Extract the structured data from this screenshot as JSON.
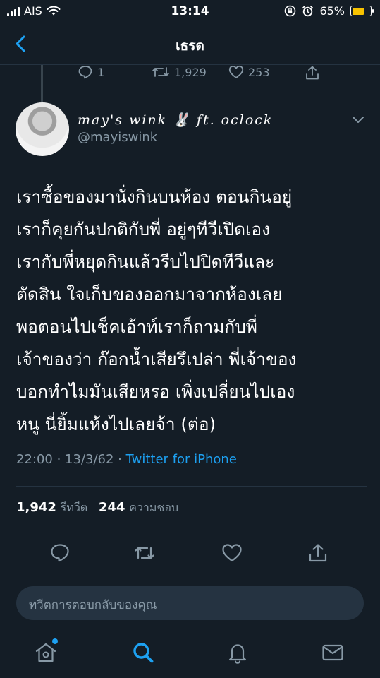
{
  "status_bar": {
    "carrier": "AIS",
    "time": "13:14",
    "battery": "65%",
    "battery_level": 0.65
  },
  "nav": {
    "title": "เธรด"
  },
  "prev_tweet": {
    "replies": "1",
    "retweets": "1,929",
    "likes": "253"
  },
  "tweet": {
    "display_name": "may's wink 🐰 ft. oclock",
    "handle": "@mayiswink",
    "lines": [
      "เราซื้อของมานั่งกินบนห้อง ตอนกินอยู่",
      "เราก็คุยกันปกติกับพี่ อยู่ๆทีวีเปิดเอง",
      "เรากับพี่หยุดกินแล้วรีบไปปิดทีวีและ",
      "ตัดสิน ใจเก็บของออกมาจากห้องเลย",
      "พอตอนไปเช็คเอ้าท์เราก็ถามกับพี่",
      "เจ้าของว่า ก๊อกน้ำเสียรึเปล่า พี่เจ้าของ",
      "บอกทำไมมันเสียหรอ เพิ่งเปลี่ยนไปเอง",
      "หนู นี่ยิ้มแห้งไปเลยจ้า (ต่อ)"
    ],
    "timestamp": "22:00 · 13/3/62 · ",
    "source": "Twitter for iPhone",
    "retweet_count": "1,942",
    "retweet_label": "รีทวีต",
    "like_count": "244",
    "like_label": "ความชอบ"
  },
  "reply": {
    "placeholder": "ทวีตการตอบกลับของคุณ"
  },
  "colors": {
    "background": "#141d26",
    "accent": "#1da1f2",
    "muted": "#8899a6",
    "battery": "#f7c200"
  }
}
